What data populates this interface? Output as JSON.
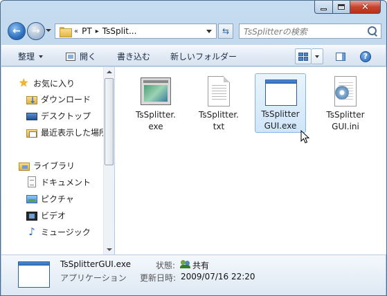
{
  "window": {
    "caption_buttons": {
      "minimize": "minimize",
      "maximize": "maximize",
      "close": "✕"
    }
  },
  "address_bar": {
    "overflow_marker": "«",
    "crumbs": [
      "PT",
      "TsSplit..."
    ],
    "separator": "▸"
  },
  "search": {
    "placeholder": "TsSplitterの検索"
  },
  "toolbar": {
    "organize": "整理",
    "open": "開く",
    "burn": "書き込む",
    "new_folder": "新しいフォルダー",
    "help": "?"
  },
  "nav_pane": {
    "favorites": "お気に入り",
    "downloads": "ダウンロード",
    "desktop": "デスクトップ",
    "recent": "最近表示した場所",
    "libraries": "ライブラリ",
    "documents": "ドキュメント",
    "pictures": "ピクチャ",
    "videos": "ビデオ",
    "music": "ミュージック"
  },
  "files": [
    {
      "name_line1": "TsSplitter.",
      "name_line2": "exe",
      "icon": "exe-icon",
      "selected": false
    },
    {
      "name_line1": "TsSplitter.",
      "name_line2": "txt",
      "icon": "text-file-icon",
      "selected": false
    },
    {
      "name_line1": "TsSplitter",
      "name_line2": "GUI.exe",
      "icon": "window-app-icon",
      "selected": true
    },
    {
      "name_line1": "TsSplitter",
      "name_line2": "GUI.ini",
      "icon": "settings-file-icon",
      "selected": false
    }
  ],
  "details": {
    "file_name": "TsSplitterGUI.exe",
    "file_type": "アプリケーション",
    "status_label": "状態:",
    "status_value": "共有",
    "modified_label": "更新日時:",
    "modified_value": "2009/07/16 22:20"
  },
  "colors": {
    "window_frame": "#a9c6e3",
    "selection_fill": "#cfe5fa",
    "selection_border": "#7eb4ea",
    "close_button": "#c7452e"
  }
}
